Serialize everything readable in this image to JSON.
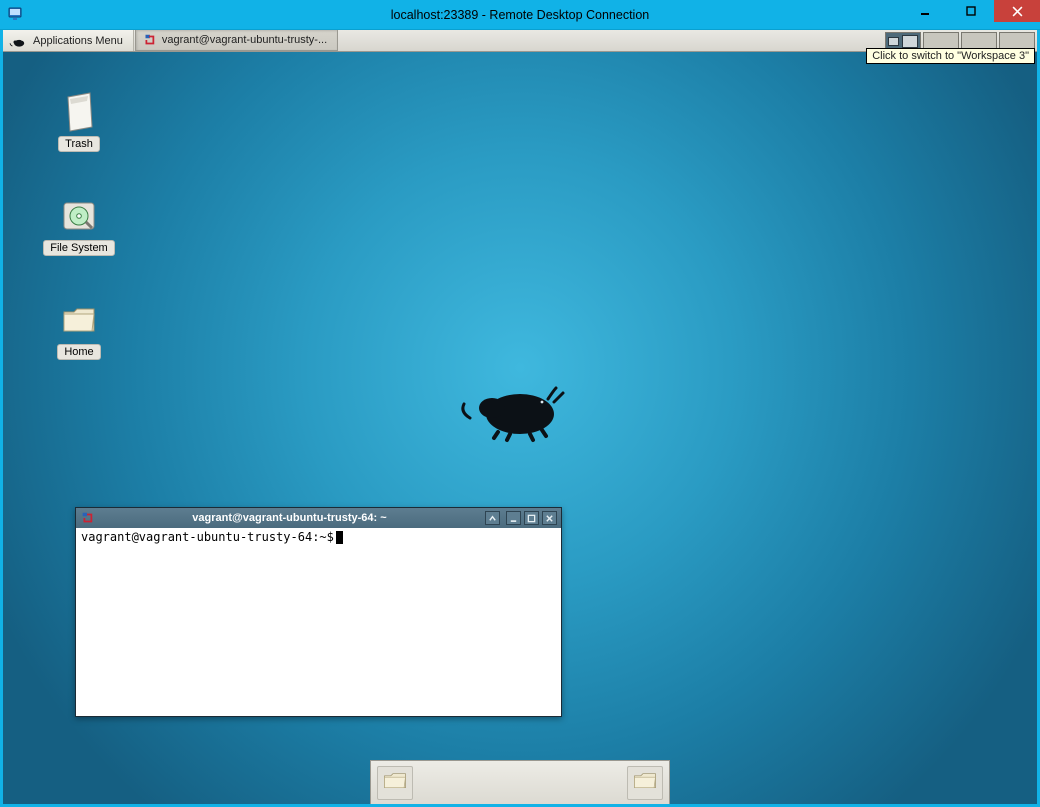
{
  "rdp": {
    "title": "localhost:23389 - Remote Desktop Connection"
  },
  "panel": {
    "apps_menu_label": "Applications Menu",
    "task_label": "vagrant@vagrant-ubuntu-trusty-...",
    "workspace_tooltip": "Click to switch to \"Workspace 3\""
  },
  "desktop": {
    "icons": {
      "trash": "Trash",
      "filesystem": "File System",
      "home": "Home"
    }
  },
  "terminal": {
    "title": "vagrant@vagrant-ubuntu-trusty-64: ~",
    "prompt": "vagrant@vagrant-ubuntu-trusty-64:~$"
  }
}
